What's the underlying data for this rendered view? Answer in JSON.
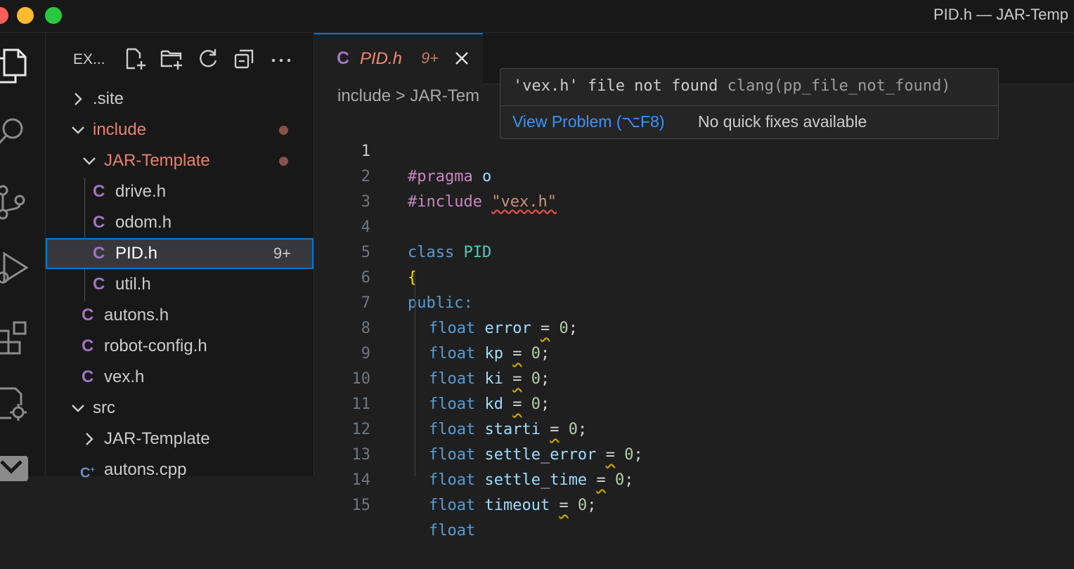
{
  "window": {
    "title": "PID.h — JAR-Temp",
    "traffic_lights": {
      "close": "#fe5f57",
      "minimize": "#febc2e",
      "zoom": "#28c840"
    }
  },
  "activity_bar": {
    "icons": [
      "explorer-icon",
      "search-icon",
      "source-control-icon",
      "run-debug-icon",
      "extensions-icon",
      "cpp-settings-icon",
      "vex-icon"
    ]
  },
  "sidebar": {
    "title": "EX...",
    "tools": [
      "new-file-icon",
      "new-folder-icon",
      "refresh-icon",
      "collapse-all-icon",
      "more-icon"
    ],
    "tree": [
      {
        "label": ".site",
        "kind": "folder",
        "expanded": false
      },
      {
        "label": "include",
        "kind": "folder",
        "expanded": true,
        "modified": true
      },
      {
        "label": "JAR-Template",
        "kind": "folder",
        "expanded": true,
        "modified": true
      },
      {
        "label": "drive.h",
        "kind": "c-header"
      },
      {
        "label": "odom.h",
        "kind": "c-header"
      },
      {
        "label": "PID.h",
        "kind": "c-header",
        "selected": true,
        "badge": "9+"
      },
      {
        "label": "util.h",
        "kind": "c-header"
      },
      {
        "label": "autons.h",
        "kind": "c-header"
      },
      {
        "label": "robot-config.h",
        "kind": "c-header"
      },
      {
        "label": "vex.h",
        "kind": "c-header"
      },
      {
        "label": "src",
        "kind": "folder",
        "expanded": true
      },
      {
        "label": "JAR-Template",
        "kind": "folder",
        "expanded": false
      },
      {
        "label": "autons.cpp",
        "kind": "cpp-source"
      }
    ]
  },
  "tab": {
    "icon_label": "C",
    "name": "PID.h",
    "badge": "9+"
  },
  "breadcrumb": {
    "text": "include > JAR-Tem"
  },
  "hover": {
    "message": "'vex.h' file not found",
    "source": "clang(pp_file_not_found)",
    "view_problem": "View Problem (⌥F8)",
    "no_fixes": "No quick fixes available"
  },
  "code": {
    "current_line": 1,
    "lines": [
      "1",
      "2",
      "3",
      "4",
      "5",
      "6",
      "7",
      "8",
      "9",
      "10",
      "11",
      "12",
      "13",
      "14",
      "15"
    ],
    "l1": {
      "directive": "#pragma",
      "rest": "o"
    },
    "l2": {
      "directive": "#include",
      "path": "\"vex.h\""
    },
    "l4": {
      "kw": "class",
      "name": "PID"
    },
    "l5": {
      "brace": "{"
    },
    "l6": {
      "access": "public",
      "colon": ":"
    },
    "fields": [
      {
        "type": "float",
        "name": "error",
        "value": "0"
      },
      {
        "type": "float",
        "name": "kp",
        "value": "0"
      },
      {
        "type": "float",
        "name": "ki",
        "value": "0"
      },
      {
        "type": "float",
        "name": "kd",
        "value": "0"
      },
      {
        "type": "float",
        "name": "starti",
        "value": "0"
      },
      {
        "type": "float",
        "name": "settle_error",
        "value": "0"
      },
      {
        "type": "float",
        "name": "settle_time",
        "value": "0"
      },
      {
        "type": "float",
        "name": "timeout",
        "value": "0"
      }
    ],
    "l15": "float"
  }
}
